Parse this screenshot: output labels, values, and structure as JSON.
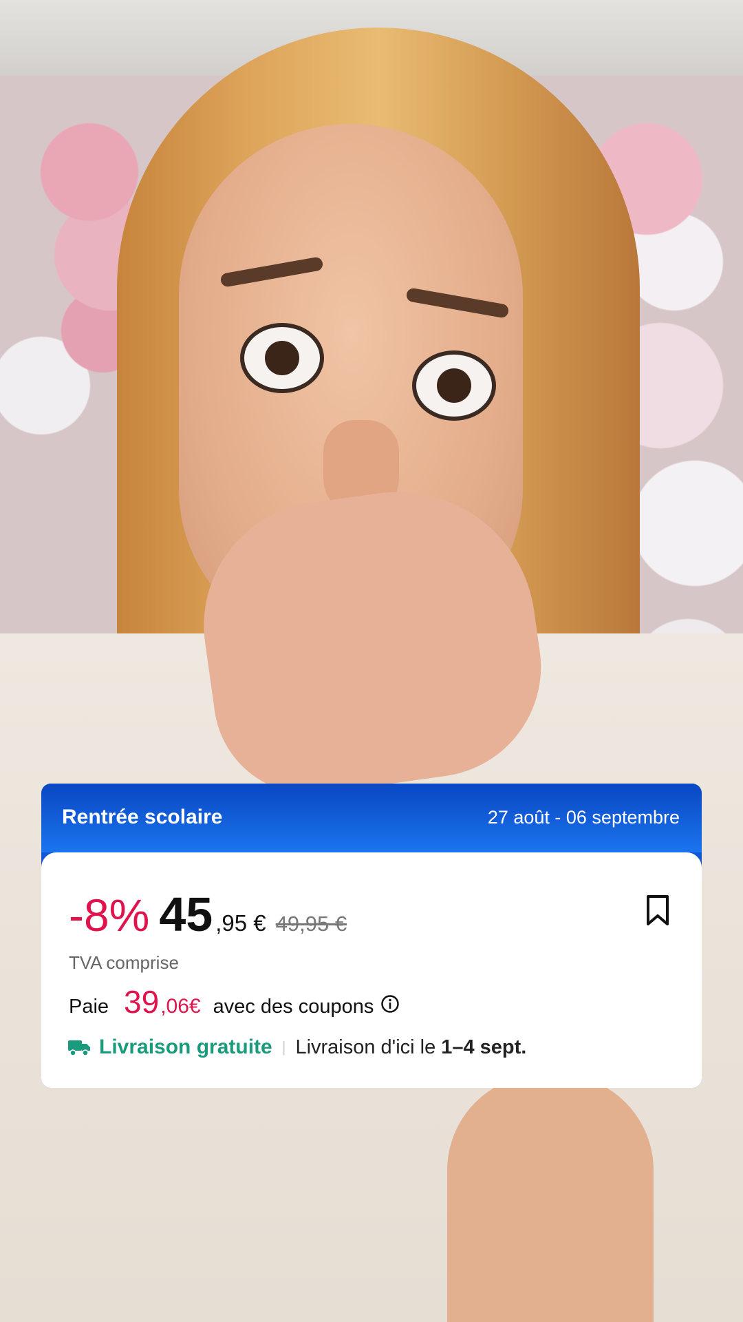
{
  "promo": {
    "title": "Rentrée scolaire",
    "dates": "27 août - 06 septembre"
  },
  "price": {
    "discount": "-8%",
    "integer": "45",
    "decimal": ",95 €",
    "original": "49,95 €",
    "vat_note": "TVA comprise"
  },
  "coupon": {
    "prefix": "Paie",
    "integer": "39",
    "decimal": ",06€",
    "suffix": "avec des coupons"
  },
  "shipping": {
    "free_label": "Livraison gratuite",
    "separator": "|",
    "delivery_prefix": "Livraison d'ici le",
    "delivery_dates": "1–4 sept."
  },
  "icons": {
    "bookmark": "bookmark-icon",
    "info": "info-icon",
    "truck": "truck-icon"
  },
  "colors": {
    "header_blue": "#1158d7",
    "discount_red": "#e0134d",
    "shipping_green": "#1a9b7d"
  }
}
